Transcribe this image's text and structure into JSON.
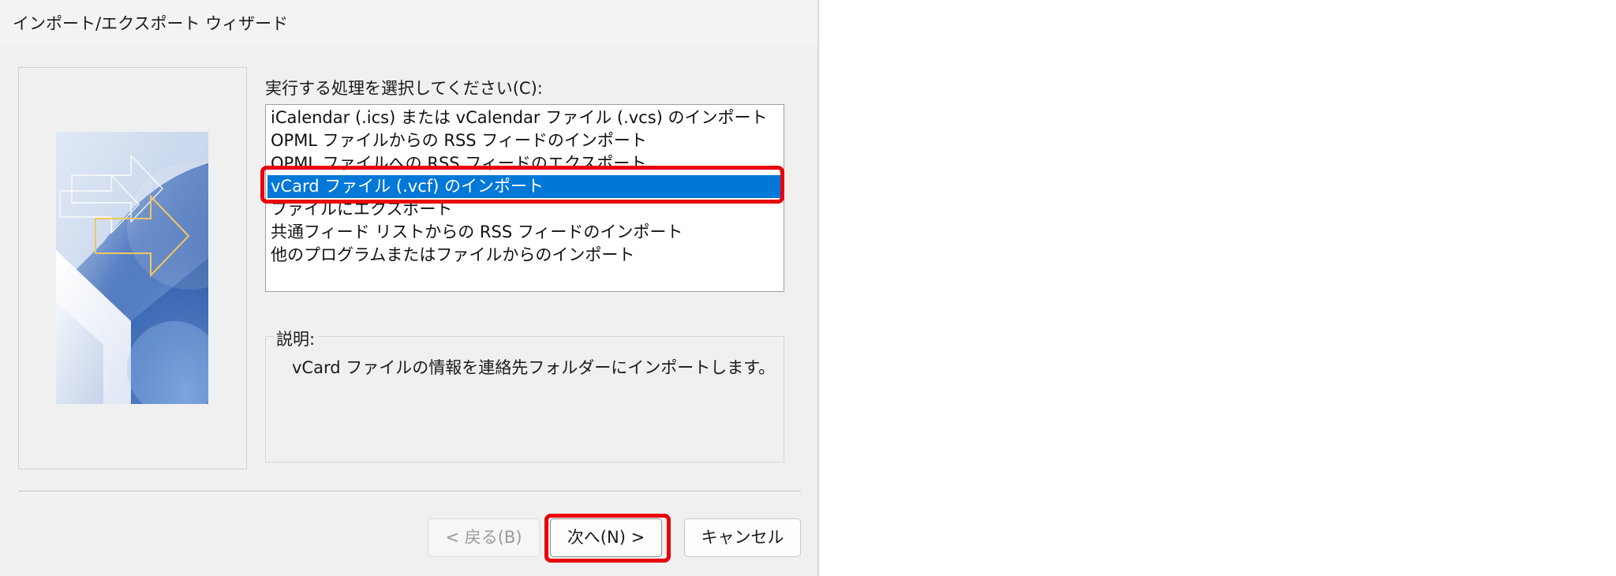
{
  "window": {
    "title": "インポート/エクスポート ウィザード"
  },
  "prompt_label": "実行する処理を選択してください(C):",
  "actions": [
    "iCalendar (.ics) または vCalendar ファイル (.vcs) のインポート",
    "OPML ファイルからの RSS フィードのインポート",
    "OPML ファイルへの RSS フィードのエクスポート",
    "vCard ファイル (.vcf) のインポート",
    "ファイルにエクスポート",
    "共通フィード リストからの RSS フィードのインポート",
    "他のプログラムまたはファイルからのインポート"
  ],
  "selected_action_index": 3,
  "description": {
    "label": "説明:",
    "text": "vCard ファイルの情報を連絡先フォルダーにインポートします。"
  },
  "buttons": {
    "back": "< 戻る(B)",
    "next": "次へ(N) >",
    "cancel": "キャンセル"
  },
  "colors": {
    "selection": "#0078d7",
    "highlight_annotation": "#e8000b",
    "dialog_background": "#f0f0f0"
  }
}
